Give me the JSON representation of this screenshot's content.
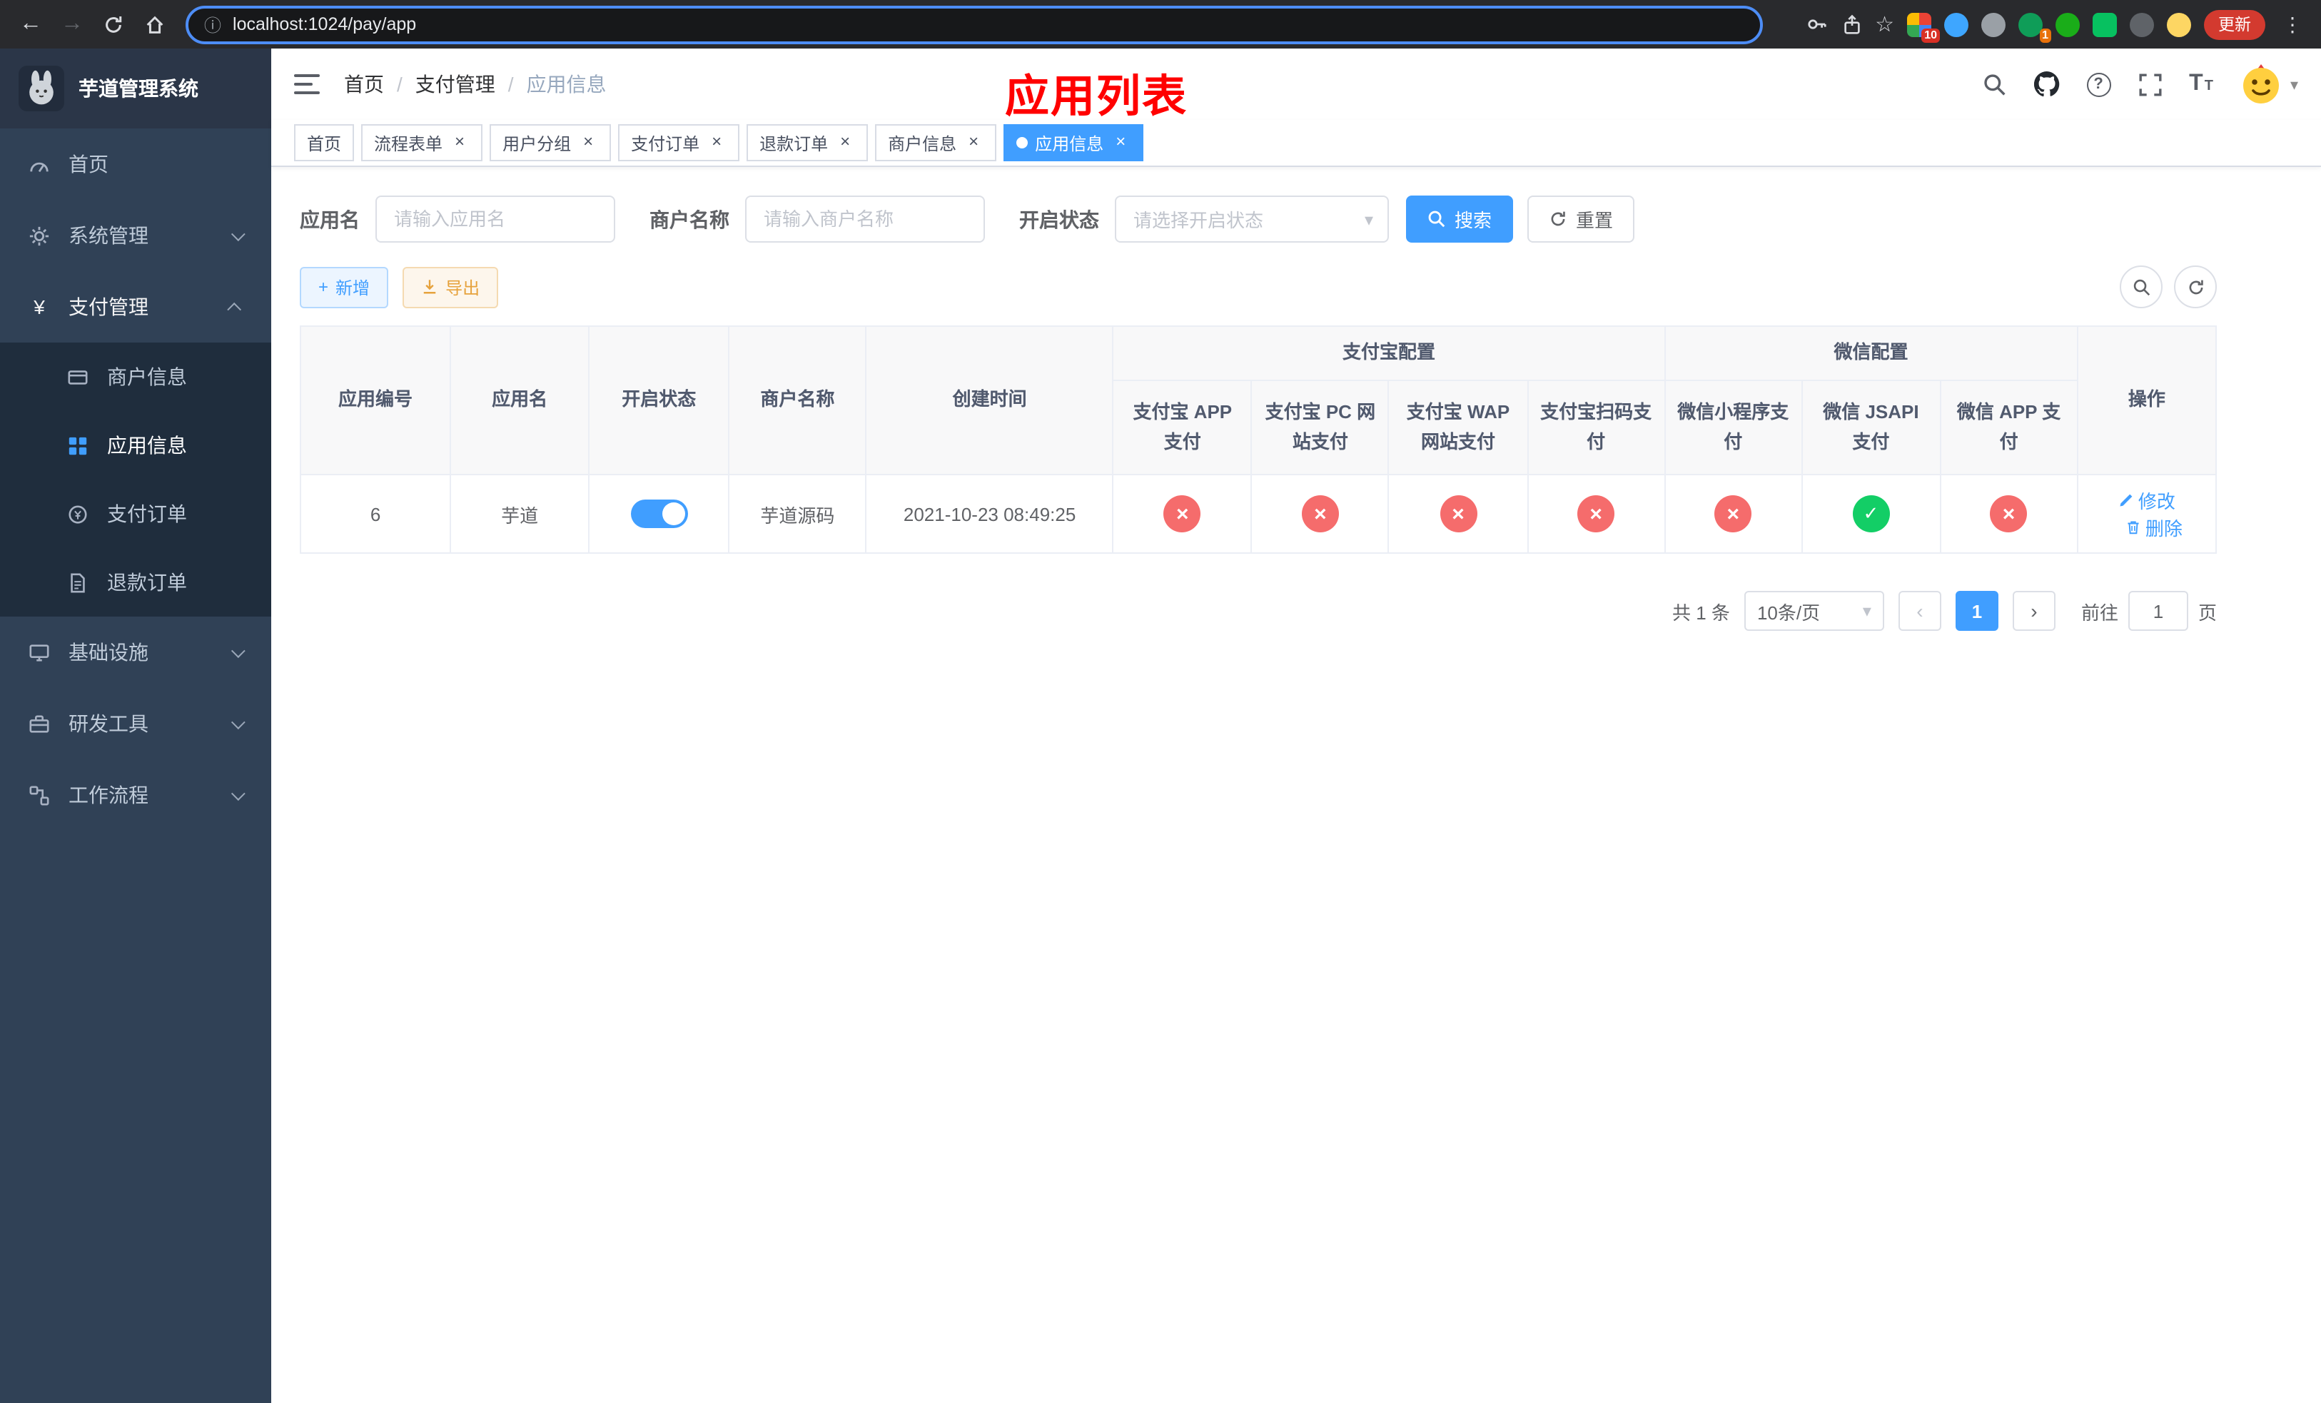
{
  "browser": {
    "url": "localhost:1024/pay/app",
    "update_button": "更新",
    "ext_badge_grid": "10",
    "ext_badge_avatar": "1"
  },
  "sidebar": {
    "logo_title": "芋道管理系统",
    "items": [
      {
        "label": "首页"
      },
      {
        "label": "系统管理"
      },
      {
        "label": "支付管理"
      },
      {
        "label": "基础设施"
      },
      {
        "label": "研发工具"
      },
      {
        "label": "工作流程"
      }
    ],
    "submenu": [
      {
        "label": "商户信息"
      },
      {
        "label": "应用信息"
      },
      {
        "label": "支付订单"
      },
      {
        "label": "退款订单"
      }
    ]
  },
  "header": {
    "breadcrumb": [
      {
        "label": "首页"
      },
      {
        "label": "支付管理"
      },
      {
        "label": "应用信息"
      }
    ],
    "separator": "/",
    "overlay_title": "应用列表"
  },
  "tabs": [
    {
      "label": "首页"
    },
    {
      "label": "流程表单"
    },
    {
      "label": "用户分组"
    },
    {
      "label": "支付订单"
    },
    {
      "label": "退款订单"
    },
    {
      "label": "商户信息"
    },
    {
      "label": "应用信息"
    }
  ],
  "filters": {
    "app_name_label": "应用名",
    "app_name_placeholder": "请输入应用名",
    "merchant_label": "商户名称",
    "merchant_placeholder": "请输入商户名称",
    "status_label": "开启状态",
    "status_placeholder": "请选择开启状态",
    "search_button": "搜索",
    "reset_button": "重置"
  },
  "toolbar": {
    "add_button": "新增",
    "export_button": "导出"
  },
  "table": {
    "headers": {
      "app_id": "应用编号",
      "app_name": "应用名",
      "status": "开启状态",
      "merchant": "商户名称",
      "created": "创建时间",
      "alipay_group": "支付宝配置",
      "wechat_group": "微信配置",
      "alipay_app": "支付宝 APP 支付",
      "alipay_pc": "支付宝 PC 网站支付",
      "alipay_wap": "支付宝 WAP 网站支付",
      "alipay_qr": "支付宝扫码支付",
      "wx_mini": "微信小程序支付",
      "wx_jsapi": "微信 JSAPI 支付",
      "wx_app": "微信 APP 支付",
      "actions": "操作"
    },
    "rows": [
      {
        "app_id": "6",
        "app_name": "芋道",
        "status_toggle": "on",
        "merchant": "芋道源码",
        "created": "2021-10-23 08:49:25",
        "alipay_app": "disabled",
        "alipay_pc": "disabled",
        "alipay_wap": "disabled",
        "alipay_qr": "disabled",
        "wx_mini": "disabled",
        "wx_jsapi": "enabled",
        "wx_app": "disabled",
        "edit_label": "修改",
        "delete_label": "删除"
      }
    ]
  },
  "pagination": {
    "total": "共 1 条",
    "page_size": "10条/页",
    "page": "1",
    "goto_label": "前往",
    "goto_value": "1",
    "goto_suffix": "页"
  },
  "icons": {
    "close": "×",
    "caret": "▾",
    "back": "←",
    "forward": "→",
    "info": "ⓘ",
    "star": "☆",
    "more": "⋮",
    "prev": "‹",
    "next": "›",
    "plus": "+",
    "yen": "¥",
    "question": "?",
    "t": "T"
  },
  "colors": {
    "accent": "#409eff",
    "danger": "#f56c6c",
    "success": "#13ce66",
    "warning": "#e6a23c",
    "title_red": "#ff0000",
    "sidebar_bg": "#304156",
    "submenu_bg": "#1f2d3d"
  }
}
